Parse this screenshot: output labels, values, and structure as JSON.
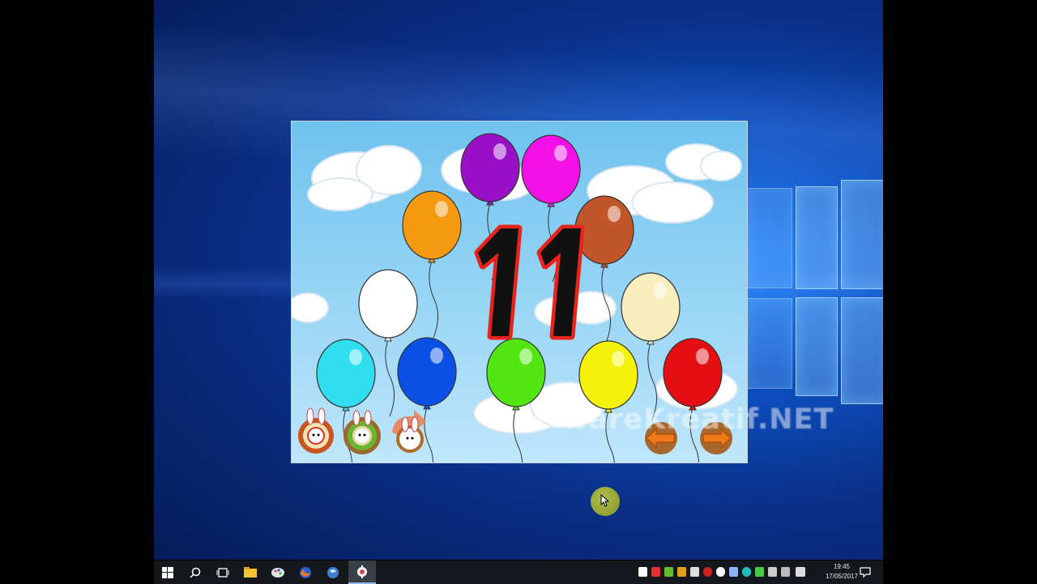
{
  "game": {
    "number": "11",
    "watermark": "SoftwareKreatif.NET",
    "balloon_colors": [
      "#9a10c8",
      "#f210e6",
      "#f59a10",
      "#c0562a",
      "#ffffff",
      "#f9edbd",
      "#30dfef",
      "#0a4fe6",
      "#53e612",
      "#f5f20a",
      "#e40f12"
    ],
    "buttons": {
      "home_icon": "bunny-target-icon",
      "settings_icon": "bunny-gear-icon",
      "back_icon": "bunny-return-icon",
      "prev_icon": "arrow-left-icon",
      "next_icon": "arrow-right-icon"
    }
  },
  "taskbar": {
    "items": [
      "start-icon",
      "search-icon",
      "task-view-icon",
      "file-explorer-icon",
      "paint-icon",
      "firefox-icon",
      "app-globe-icon",
      "game-app-icon"
    ],
    "clock_time": "19:45",
    "clock_date": "17/05/2017"
  }
}
